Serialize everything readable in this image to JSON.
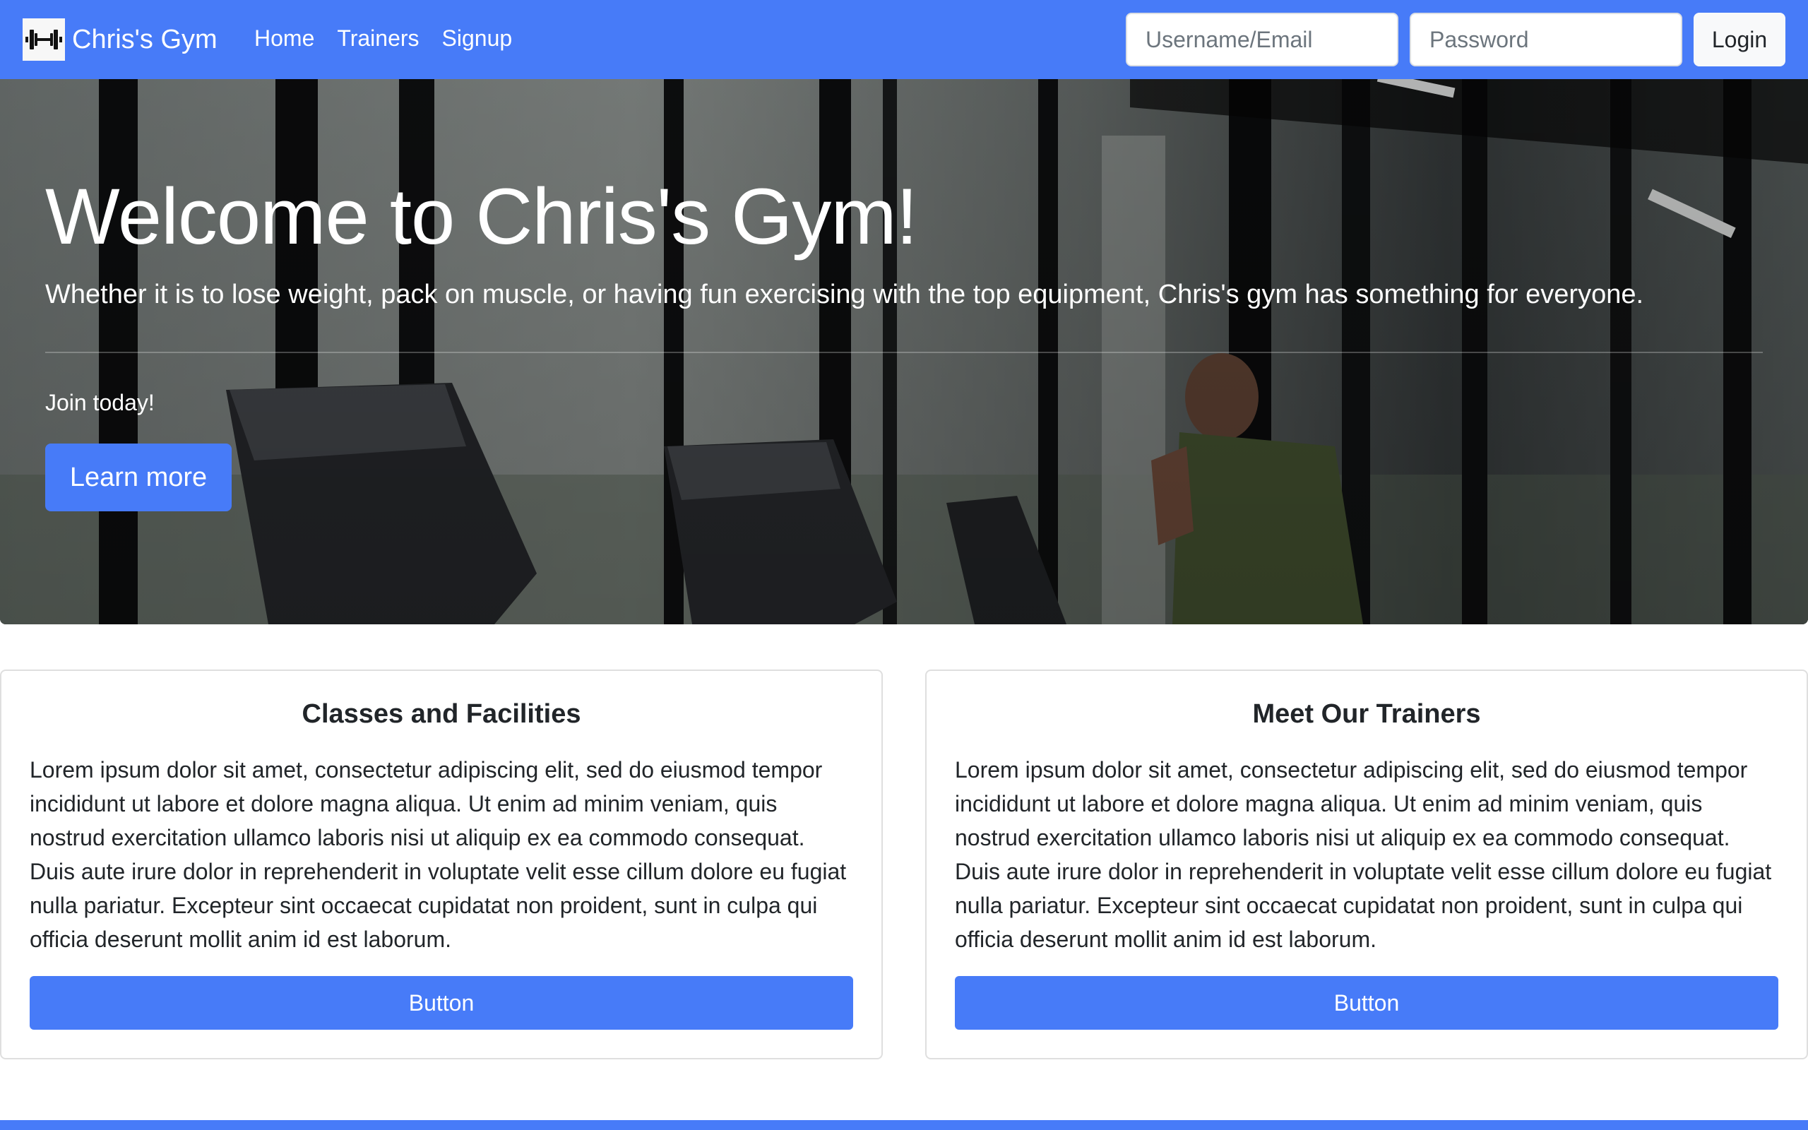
{
  "navbar": {
    "brand": "Chris's Gym",
    "brand_icon": "dumbbell-icon",
    "links": [
      "Home",
      "Trainers",
      "Signup"
    ],
    "username_placeholder": "Username/Email",
    "password_placeholder": "Password",
    "login_label": "Login"
  },
  "hero": {
    "title": "Welcome to Chris's Gym!",
    "lead": "Whether it is to lose weight, pack on muscle, or having fun exercising with the top equipment, Chris's gym has something for everyone.",
    "join_text": "Join today!",
    "button_label": "Learn more"
  },
  "cards": [
    {
      "title": "Classes and Facilities",
      "text": "Lorem ipsum dolor sit amet, consectetur adipiscing elit, sed do eiusmod tempor incididunt ut labore et dolore magna aliqua. Ut enim ad minim veniam, quis nostrud exercitation ullamco laboris nisi ut aliquip ex ea commodo consequat. Duis aute irure dolor in reprehenderit in voluptate velit esse cillum dolore eu fugiat nulla pariatur. Excepteur sint occaecat cupidatat non proident, sunt in culpa qui officia deserunt mollit anim id est laborum.",
      "button_label": "Button"
    },
    {
      "title": "Meet Our Trainers",
      "text": "Lorem ipsum dolor sit amet, consectetur adipiscing elit, sed do eiusmod tempor incididunt ut labore et dolore magna aliqua. Ut enim ad minim veniam, quis nostrud exercitation ullamco laboris nisi ut aliquip ex ea commodo consequat. Duis aute irure dolor in reprehenderit in voluptate velit esse cillum dolore eu fugiat nulla pariatur. Excepteur sint occaecat cupidatat non proident, sunt in culpa qui officia deserunt mollit anim id est laborum.",
      "button_label": "Button"
    }
  ],
  "colors": {
    "primary": "#477bf8",
    "light_button": "#f8f9fa",
    "card_border": "#dfdfdf"
  }
}
